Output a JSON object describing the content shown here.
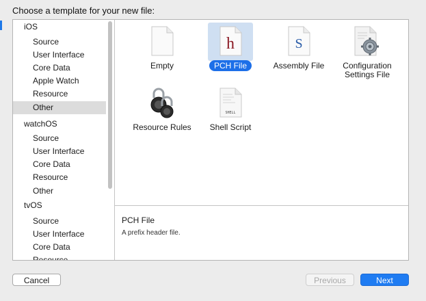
{
  "dialog": {
    "title": "Choose a template for your new file:"
  },
  "sidebar": {
    "items": [
      {
        "label": "iOS",
        "kind": "section"
      },
      {
        "label": "Source",
        "kind": "sub"
      },
      {
        "label": "User Interface",
        "kind": "sub"
      },
      {
        "label": "Core Data",
        "kind": "sub"
      },
      {
        "label": "Apple Watch",
        "kind": "sub"
      },
      {
        "label": "Resource",
        "kind": "sub"
      },
      {
        "label": "Other",
        "kind": "sub",
        "selected": true
      },
      {
        "label": "watchOS",
        "kind": "section"
      },
      {
        "label": "Source",
        "kind": "sub"
      },
      {
        "label": "User Interface",
        "kind": "sub"
      },
      {
        "label": "Core Data",
        "kind": "sub"
      },
      {
        "label": "Resource",
        "kind": "sub"
      },
      {
        "label": "Other",
        "kind": "sub"
      },
      {
        "label": "tvOS",
        "kind": "section"
      },
      {
        "label": "Source",
        "kind": "sub"
      },
      {
        "label": "User Interface",
        "kind": "sub"
      },
      {
        "label": "Core Data",
        "kind": "sub"
      },
      {
        "label": "Resource",
        "kind": "sub"
      }
    ]
  },
  "templates": [
    {
      "label": "Empty",
      "icon": "empty-file-icon"
    },
    {
      "label": "PCH File",
      "icon": "pch-file-icon",
      "glyph": "h",
      "selected": true
    },
    {
      "label": "Assembly File",
      "icon": "assembly-file-icon",
      "glyph": "S"
    },
    {
      "label": "Configuration Settings File",
      "icon": "config-settings-file-icon"
    },
    {
      "label": "Resource Rules",
      "icon": "resource-rules-lock-icon"
    },
    {
      "label": "Shell Script",
      "icon": "shell-script-icon",
      "glyph": "SHELL"
    }
  ],
  "description": {
    "title": "PCH File",
    "text": "A prefix header file."
  },
  "buttons": {
    "cancel": "Cancel",
    "previous": "Previous",
    "next": "Next"
  },
  "colors": {
    "accent": "#1d6fe8",
    "selection_bg": "#cfdff2",
    "sidebar_selection": "#dcdcdc",
    "pch_glyph": "#8b1a24",
    "asm_glyph": "#2a5ca8"
  }
}
